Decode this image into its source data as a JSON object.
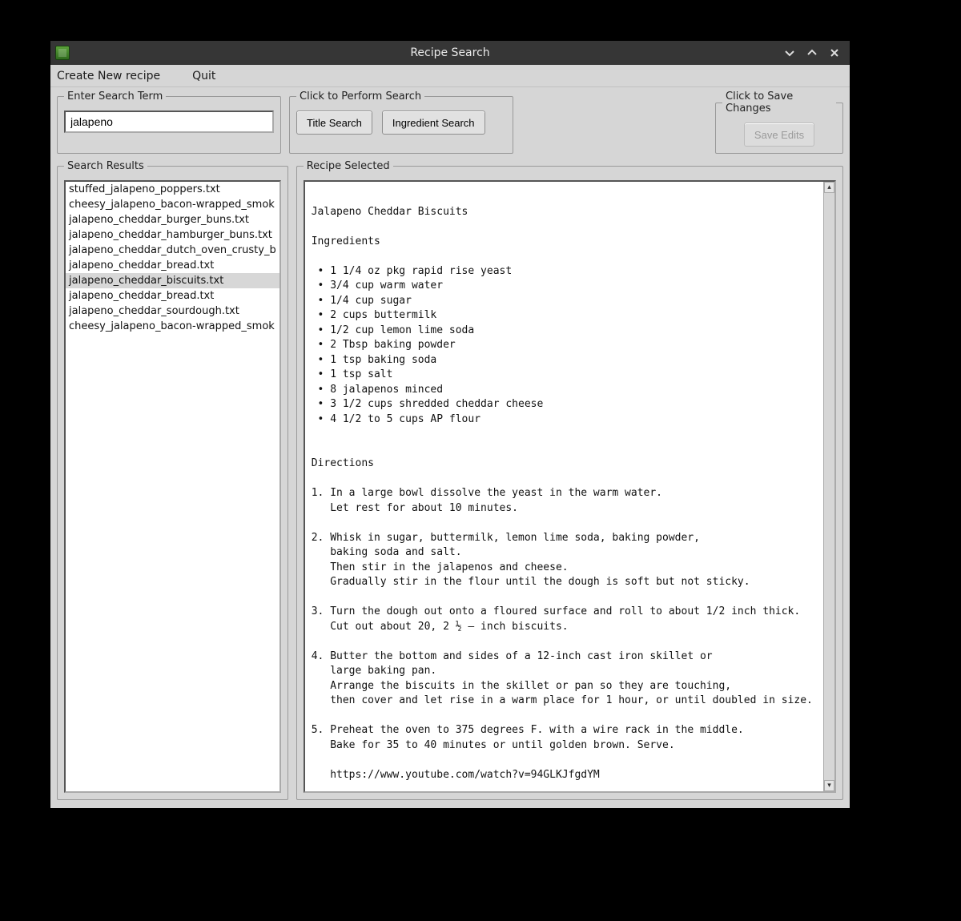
{
  "window": {
    "title": "Recipe Search"
  },
  "menu": {
    "create": "Create New recipe",
    "quit": "Quit"
  },
  "search_group": {
    "legend": "Enter Search Term",
    "value": "jalapeno"
  },
  "perform_group": {
    "legend": "Click to Perform Search",
    "title_btn": "Title Search",
    "ingredient_btn": "Ingredient Search"
  },
  "save_group": {
    "legend": "Click to Save Changes",
    "save_btn": "Save Edits"
  },
  "results_group": {
    "legend": "Search Results",
    "items": [
      "stuffed_jalapeno_poppers.txt",
      "cheesy_jalapeno_bacon-wrapped_smok",
      "jalapeno_cheddar_burger_buns.txt",
      "jalapeno_cheddar_hamburger_buns.txt",
      "jalapeno_cheddar_dutch_oven_crusty_b",
      "jalapeno_cheddar_bread.txt",
      "jalapeno_cheddar_biscuits.txt",
      "jalapeno_cheddar_bread.txt",
      "jalapeno_cheddar_sourdough.txt",
      "cheesy_jalapeno_bacon-wrapped_smok"
    ],
    "selected_index": 6
  },
  "selected_group": {
    "legend": "Recipe Selected",
    "text": "\nJalapeno Cheddar Biscuits\n\nIngredients\n\n • 1 1/4 oz pkg rapid rise yeast\n • 3/4 cup warm water\n • 1/4 cup sugar\n • 2 cups buttermilk\n • 1/2 cup lemon lime soda\n • 2 Tbsp baking powder\n • 1 tsp baking soda\n • 1 tsp salt\n • 8 jalapenos minced\n • 3 1/2 cups shredded cheddar cheese\n • 4 1/2 to 5 cups AP flour\n\n\nDirections\n\n1. In a large bowl dissolve the yeast in the warm water.\n   Let rest for about 10 minutes.\n\n2. Whisk in sugar, buttermilk, lemon lime soda, baking powder,\n   baking soda and salt.\n   Then stir in the jalapenos and cheese.\n   Gradually stir in the flour until the dough is soft but not sticky.\n\n3. Turn the dough out onto a floured surface and roll to about 1/2 inch thick.\n   Cut out about 20, 2 ½ – inch biscuits.\n\n4. Butter the bottom and sides of a 12-inch cast iron skillet or\n   large baking pan.\n   Arrange the biscuits in the skillet or pan so they are touching,\n   then cover and let rise in a warm place for 1 hour, or until doubled in size.\n\n5. Preheat the oven to 375 degrees F. with a wire rack in the middle.\n   Bake for 35 to 40 minutes or until golden brown. Serve.\n\n   https://www.youtube.com/watch?v=94GLKJfgdYM"
  }
}
